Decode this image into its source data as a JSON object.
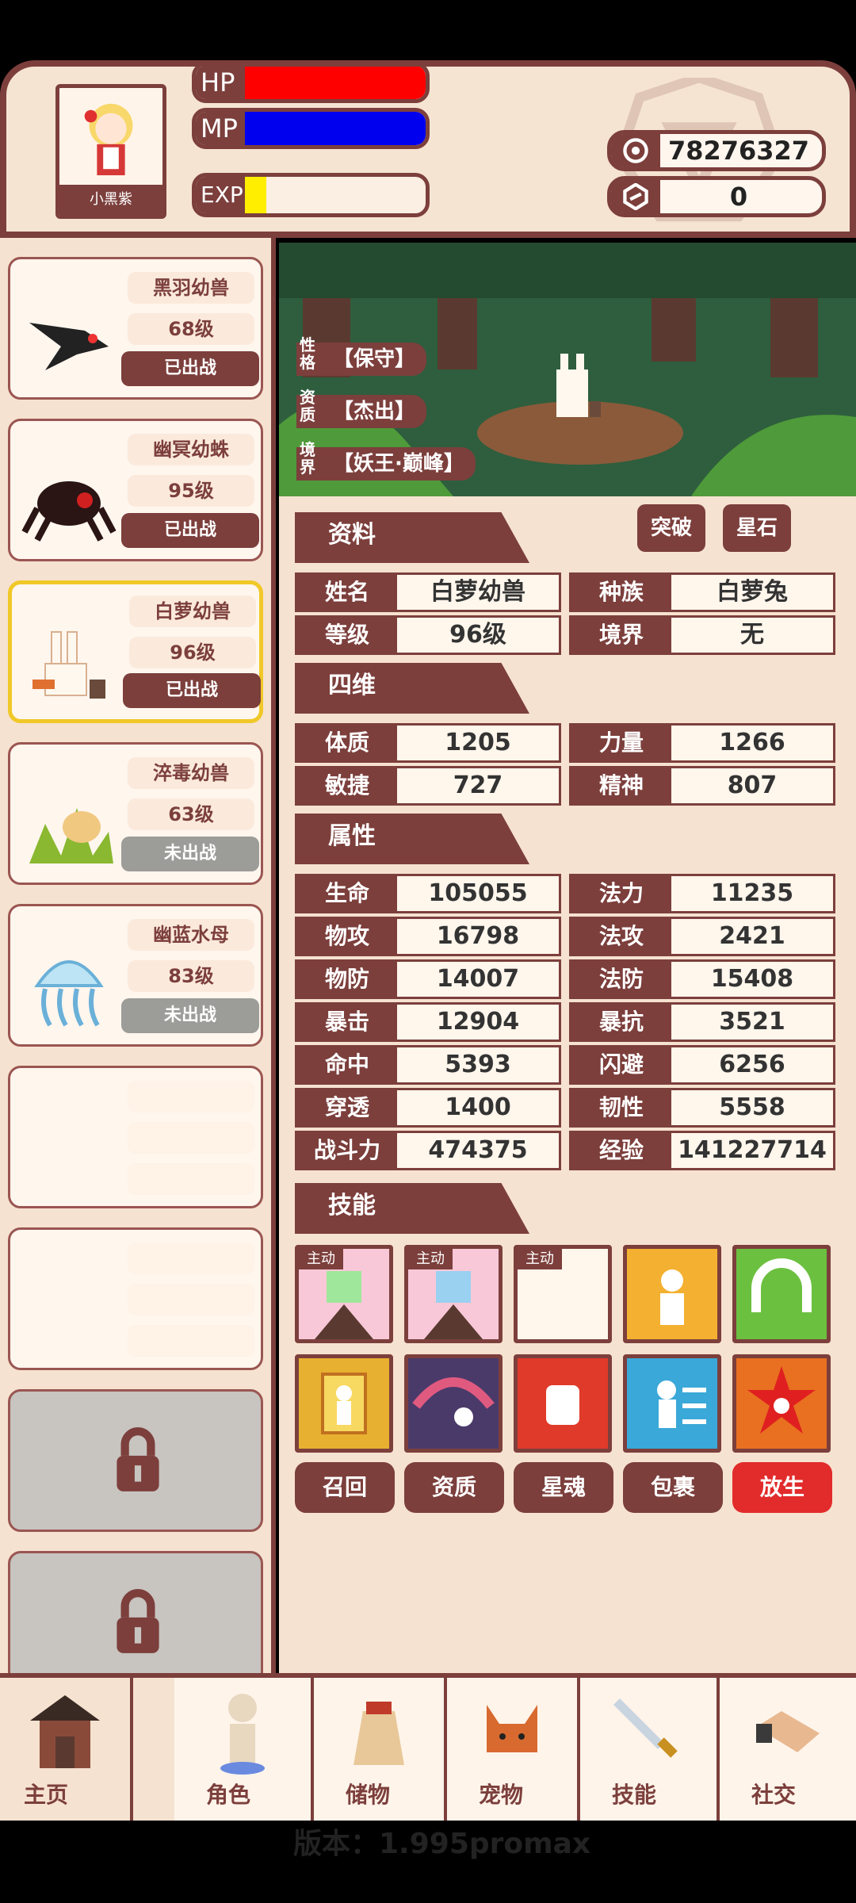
{
  "header": {
    "avatar_name": "小黑紫",
    "hp_label": "HP",
    "mp_label": "MP",
    "exp_label": "EXP",
    "hp_fraction": 1.0,
    "mp_fraction": 1.0,
    "exp_fraction": 0.12,
    "gold": "78276327",
    "gems": "0",
    "colors": {
      "hp": "#ff0000",
      "mp": "#0000ee",
      "exp": "#ffee00"
    }
  },
  "pets": [
    {
      "name": "黑羽幼兽",
      "level": "68级",
      "status": "已出战",
      "active": true,
      "selected": false
    },
    {
      "name": "幽冥幼蛛",
      "level": "95级",
      "status": "已出战",
      "active": true,
      "selected": false
    },
    {
      "name": "白萝幼兽",
      "level": "96级",
      "status": "已出战",
      "active": true,
      "selected": true
    },
    {
      "name": "淬毒幼兽",
      "level": "63级",
      "status": "未出战",
      "active": false,
      "selected": false
    },
    {
      "name": "幽蓝水母",
      "level": "83级",
      "status": "未出战",
      "active": false,
      "selected": false
    }
  ],
  "scene": {
    "nature_label": "性格",
    "nature": "【保守】",
    "aptitude_label": "资质",
    "aptitude": "【杰出】",
    "realm_label": "境界",
    "realm": "【妖王·巅峰】"
  },
  "panel": {
    "sec_info": "资料",
    "btn_break": "突破",
    "btn_star": "星石",
    "info": [
      {
        "k": "姓名",
        "v": "白萝幼兽"
      },
      {
        "k": "种族",
        "v": "白萝兔"
      },
      {
        "k": "等级",
        "v": "96级"
      },
      {
        "k": "境界",
        "v": "无"
      }
    ],
    "sec_four": "四维",
    "four": [
      {
        "k": "体质",
        "v": "1205"
      },
      {
        "k": "力量",
        "v": "1266"
      },
      {
        "k": "敏捷",
        "v": "727"
      },
      {
        "k": "精神",
        "v": "807"
      }
    ],
    "sec_attr": "属性",
    "attrs": [
      {
        "k": "生命",
        "v": "105055"
      },
      {
        "k": "法力",
        "v": "11235"
      },
      {
        "k": "物攻",
        "v": "16798"
      },
      {
        "k": "法攻",
        "v": "2421"
      },
      {
        "k": "物防",
        "v": "14007"
      },
      {
        "k": "法防",
        "v": "15408"
      },
      {
        "k": "暴击",
        "v": "12904"
      },
      {
        "k": "暴抗",
        "v": "3521"
      },
      {
        "k": "命中",
        "v": "5393"
      },
      {
        "k": "闪避",
        "v": "6256"
      },
      {
        "k": "穿透",
        "v": "1400"
      },
      {
        "k": "韧性",
        "v": "5558"
      },
      {
        "k": "战斗力",
        "v": "474375"
      },
      {
        "k": "经验",
        "v": "141227714"
      }
    ],
    "sec_skill": "技能",
    "active_tag": "主动",
    "actions": [
      "召回",
      "资质",
      "星魂",
      "包裹",
      "放生"
    ]
  },
  "nav": [
    "主页",
    "角色",
    "储物",
    "宠物",
    "技能",
    "社交"
  ],
  "version": "版本：1.995promax"
}
